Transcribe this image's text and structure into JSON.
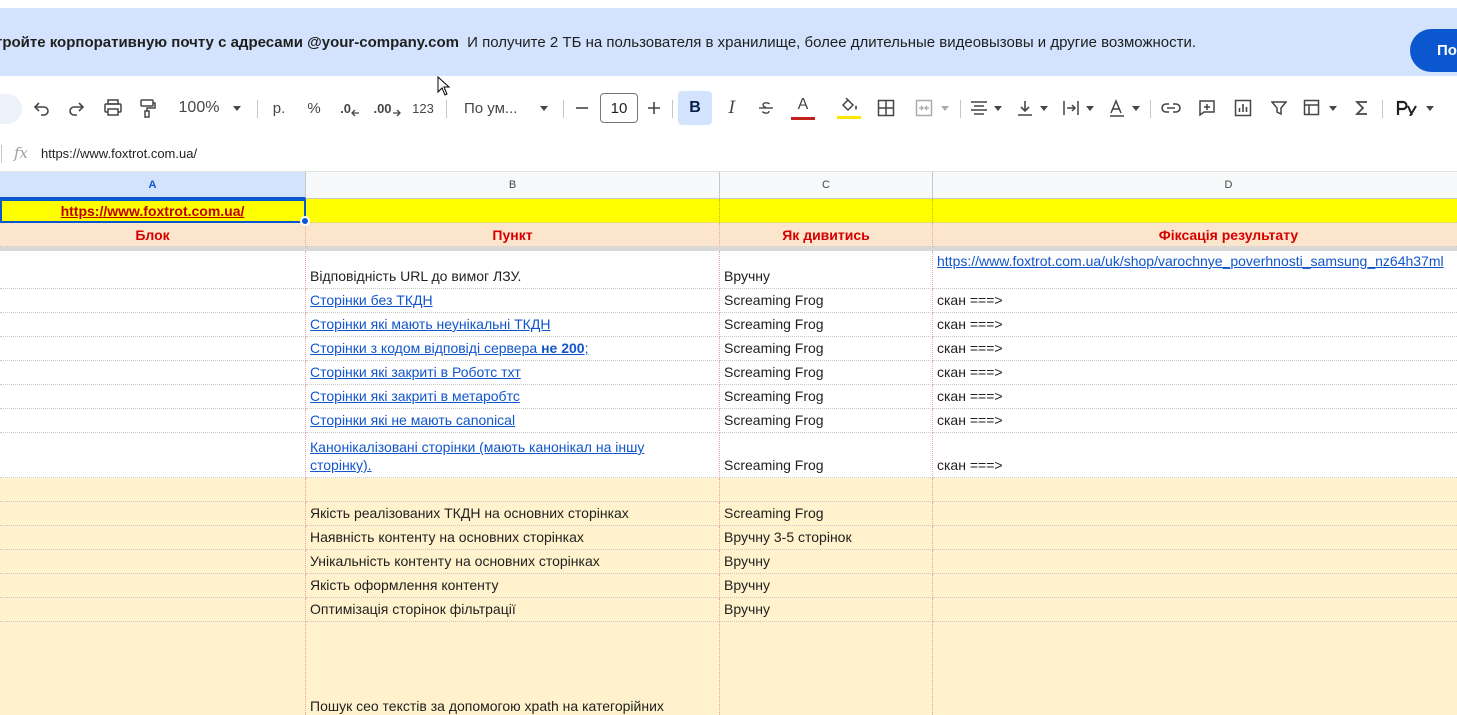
{
  "banner": {
    "text_bold": "тройте корпоративную почту с адресами @your-company.com",
    "text_rest": "И получите 2 ТБ на пользователя в хранилище, более длительные видеовызовы и другие возможности.",
    "button_label": "По"
  },
  "toolbar": {
    "zoom": "100%",
    "currency_label": "р.",
    "percent_label": "%",
    "decrease_decimals_label": ".0",
    "increase_decimals_label": ".00",
    "number_format_label": "123",
    "font_name": "По ум...",
    "font_size": "10",
    "bold_label": "B",
    "italic_label": "I",
    "text_color_label": "A",
    "accent_color": "#0b57d0",
    "text_color": "#c5221f",
    "fill_color": "#ffe600"
  },
  "formula_bar": {
    "fx_label": "fx",
    "value": "https://www.foxtrot.com.ua/"
  },
  "columns": [
    "A",
    "B",
    "C",
    "D"
  ],
  "rows": {
    "url_row": {
      "a": "https://www.foxtrot.com.ua/"
    },
    "header_row": {
      "a": "Блок",
      "b": "Пункт",
      "c": "Як дивитись",
      "d": "Фіксація результату"
    },
    "data": [
      {
        "b": "Відповідність URL до вимог ЛЗУ.",
        "c": "Вручну",
        "d": "https://www.foxtrot.com.ua/uk/shop/varochnye_poverhnosti_samsung_nz64h37ml"
      },
      {
        "b": "Сторінки без ТКДН",
        "c": "Screaming Frog",
        "d": "скан ===>"
      },
      {
        "b": "Сторінки які мають неунікальні ТКДН",
        "c": "Screaming Frog",
        "d": "скан ===>"
      },
      {
        "b": "Сторінки з кодом відповіді сервера",
        "b_bold": "не 200",
        "b_tail": ";",
        "c": "Screaming Frog",
        "d": "скан ===>"
      },
      {
        "b": "Сторінки які закриті в Роботс тхт",
        "c": "Screaming Frog",
        "d": "скан ===>"
      },
      {
        "b": "Сторінки які закриті в метаробтс",
        "c": "Screaming Frog",
        "d": "скан ===>"
      },
      {
        "b": "Сторінки які не мають canonical",
        "c": "Screaming Frog",
        "d": "скан ===>"
      },
      {
        "b": "Канонікалізовані сторінки (мають канонікал на іншу сторінку).",
        "c": "Screaming Frog",
        "d": "скан ===>"
      },
      {
        "b": "",
        "c": "",
        "d": ""
      },
      {
        "b": "Якість реалізованих ТКДН на основних сторінках",
        "c": "Screaming Frog",
        "d": ""
      },
      {
        "b": "Наявність контенту на основних сторінках",
        "c": "Вручну 3-5 сторінок",
        "d": ""
      },
      {
        "b": "Унікальність контенту на основних сторінках",
        "c": "Вручну",
        "d": ""
      },
      {
        "b": "Якість оформлення контенту",
        "c": "Вручну",
        "d": ""
      },
      {
        "b": "Оптимізація сторінок фільтрації",
        "c": "Вручну",
        "d": ""
      },
      {
        "b": "Пошук сео текстів за допомогою xpath на категорійних",
        "c": "",
        "d": ""
      }
    ]
  }
}
